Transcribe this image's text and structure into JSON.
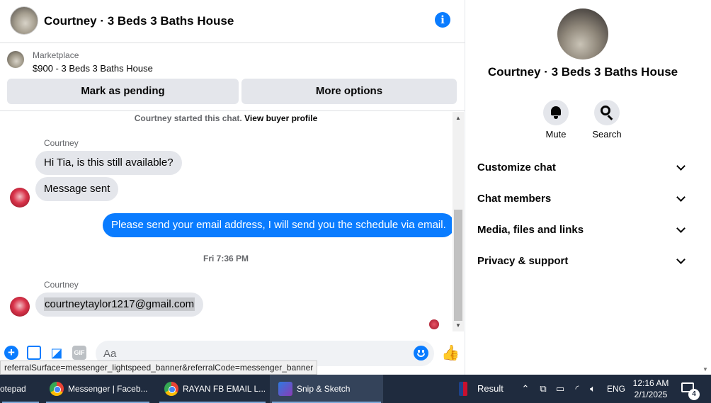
{
  "chat": {
    "title": "Courtney · 3 Beds 3 Baths House",
    "marketplace_label": "Marketplace",
    "listing": "$900 - 3 Beds 3 Baths House",
    "mark_pending_label": "Mark as pending",
    "more_options_label": "More options",
    "started_text": "Courtney started this chat.",
    "view_profile_link": "View buyer profile",
    "messages": [
      {
        "sender": "Courtney",
        "text": "Hi Tia, is this still available?"
      },
      {
        "text": "Message sent"
      },
      {
        "text": "Please send your email address, I will send you the schedule via email."
      },
      {
        "sender": "Courtney",
        "text": "courtneytaylor1217@gmail.com"
      }
    ],
    "timestamp": "Fri 7:36 PM",
    "composer_placeholder": "Aa",
    "gif_label": "GIF"
  },
  "status_url": "referralSurface=messenger_lightspeed_banner&referralCode=messenger_banner",
  "details": {
    "title": "Courtney · 3 Beds 3 Baths House",
    "mute_label": "Mute",
    "search_label": "Search",
    "sections": [
      "Customize chat",
      "Chat members",
      "Media, files and links",
      "Privacy & support"
    ]
  },
  "taskbar": {
    "items": [
      "otepad",
      "Messenger | Faceb...",
      "RAYAN FB EMAIL L...",
      "Snip & Sketch"
    ],
    "tray_result": "Result",
    "language": "ENG",
    "time": "12:16 AM",
    "date": "2/1/2025",
    "notification_count": "4"
  },
  "colors": {
    "accent": "#0a7cff",
    "bubble_in": "#e4e6eb",
    "taskbar": "#1f2b3e"
  }
}
